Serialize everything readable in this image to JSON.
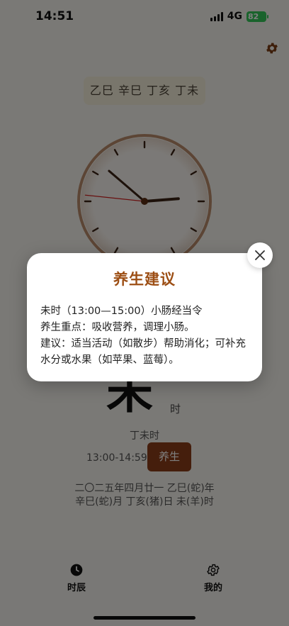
{
  "status_bar": {
    "time": "14:51",
    "network": "4G",
    "battery": "82"
  },
  "header": {
    "settings_icon": "gear-icon",
    "ganzhi_year_month_day_hour": "乙巳 辛巳 丁亥 丁未"
  },
  "clock": {
    "hour": 14,
    "minute": 51,
    "second": 46
  },
  "current": {
    "shichen": "未",
    "shi_suffix": "时",
    "ganzhi_hour": "丁未时",
    "time_range": "13:00-14:59",
    "health_button": "养生",
    "lunar_line1": "二〇二五年四月廿一 乙巳(蛇)年",
    "lunar_line2": "辛巳(蛇)月 丁亥(猪)日 未(羊)时"
  },
  "modal": {
    "title": "养生建议",
    "line1": "未时（13:00—15:00）小肠经当令",
    "line2": "养生重点：吸收营养，调理小肠。",
    "line3": "建议：适当活动（如散步）帮助消化；可补充水分或水果（如苹果、蓝莓）。",
    "close_icon": "close-icon"
  },
  "tabbar": {
    "tabs": [
      {
        "label": "时辰",
        "icon": "clock-icon"
      },
      {
        "label": "我的",
        "icon": "gear-icon"
      }
    ]
  }
}
